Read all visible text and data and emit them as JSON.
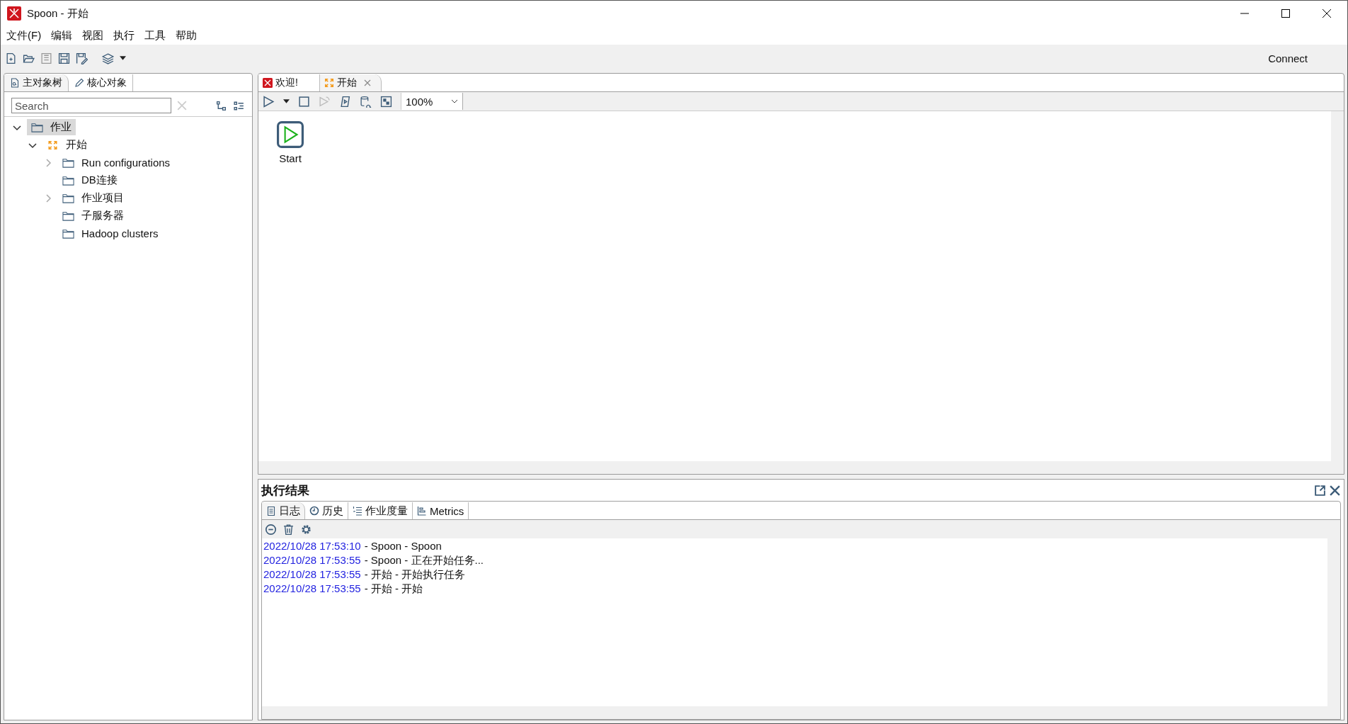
{
  "window": {
    "title": "Spoon - 开始"
  },
  "menu": [
    "文件(F)",
    "编辑",
    "视图",
    "执行",
    "工具",
    "帮助"
  ],
  "toolbar": {
    "connect": "Connect"
  },
  "left_panel": {
    "tabs": [
      {
        "label": "主对象树",
        "kind": "tree",
        "selected": true
      },
      {
        "label": "核心对象",
        "kind": "pencil",
        "selected": false
      }
    ],
    "search": {
      "placeholder": "Search"
    },
    "tree": [
      {
        "label": "作业",
        "kind": "folder",
        "selected": true,
        "expanded": true,
        "children": [
          {
            "label": "开始",
            "kind": "job",
            "selected": false,
            "expanded": true,
            "children": [
              {
                "label": "Run configurations",
                "kind": "folder",
                "selected": false,
                "expanded": false
              },
              {
                "label": "DB连接",
                "kind": "folder",
                "selected": false
              },
              {
                "label": "作业项目",
                "kind": "folder",
                "selected": false,
                "expanded": false
              },
              {
                "label": "子服务器",
                "kind": "folder",
                "selected": false
              },
              {
                "label": "Hadoop clusters",
                "kind": "folder",
                "selected": false
              }
            ]
          }
        ]
      }
    ]
  },
  "editor": {
    "tabs": [
      {
        "label": "欢迎!",
        "kind": "welcome",
        "selected": false,
        "closable": false
      },
      {
        "label": "开始",
        "kind": "job",
        "selected": true,
        "closable": true
      }
    ],
    "zoom": "100%",
    "nodes": [
      {
        "label": "Start",
        "kind": "start"
      }
    ]
  },
  "results": {
    "title": "执行结果",
    "tabs": [
      {
        "label": "日志",
        "kind": "log",
        "selected": true
      },
      {
        "label": "历史",
        "kind": "history",
        "selected": false
      },
      {
        "label": "作业度量",
        "kind": "measure",
        "selected": false
      },
      {
        "label": "Metrics",
        "kind": "metrics",
        "selected": false
      }
    ],
    "log": [
      {
        "time": "2022/10/28 17:53:10",
        "message": "- Spoon - Spoon"
      },
      {
        "time": "2022/10/28 17:53:55",
        "message": "- Spoon - 正在开始任务..."
      },
      {
        "time": "2022/10/28 17:53:55",
        "message": "- 开始 - 开始执行任务"
      },
      {
        "time": "2022/10/28 17:53:55",
        "message": "- 开始 - 开始"
      }
    ]
  }
}
